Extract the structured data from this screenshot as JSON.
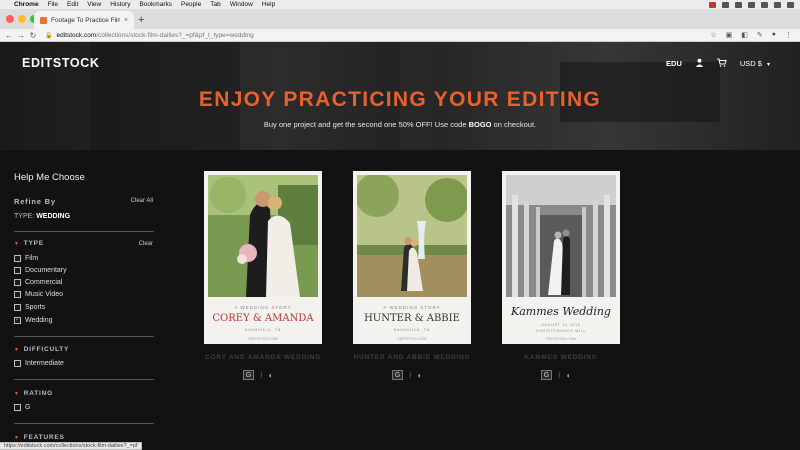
{
  "menubar": {
    "app": "Chrome",
    "items": [
      "File",
      "Edit",
      "View",
      "History",
      "Bookmarks",
      "People",
      "Tab",
      "Window",
      "Help"
    ]
  },
  "browser": {
    "tab_title": "Footage To Practice Film Editing",
    "url_host": "editstock.com",
    "url_path": "/collections/stock-film-dailies?_=pf&pf_t_type=wedding",
    "status_url": "https://editstock.com/collections/stock-film-dailies?_=pf"
  },
  "site": {
    "logo": "EDITSTOCK",
    "nav_edu": "EDU",
    "nav_currency": "USD $",
    "hero_title": "ENJOY PRACTICING YOUR EDITING",
    "hero_sub_pre": "Buy one project and get the second one 50% OFF! Use code ",
    "hero_code": "BOGO",
    "hero_sub_post": " on checkout."
  },
  "sidebar": {
    "title": "Help Me Choose",
    "refine_label": "Refine By",
    "clear_all": "Clear All",
    "active_filter_label": "TYPE:",
    "active_filter_value": "WEDDING",
    "sections": {
      "type": {
        "label": "TYPE",
        "clear": "Clear",
        "options": [
          {
            "label": "Film",
            "checked": false
          },
          {
            "label": "Documentary",
            "checked": false
          },
          {
            "label": "Commercial",
            "checked": false
          },
          {
            "label": "Music Video",
            "checked": false
          },
          {
            "label": "Sports",
            "checked": false
          },
          {
            "label": "Wedding",
            "checked": true
          }
        ]
      },
      "difficulty": {
        "label": "DIFFICULTY",
        "options": [
          {
            "label": "Intermediate",
            "checked": false
          }
        ]
      },
      "rating": {
        "label": "RATING",
        "options": [
          {
            "label": "G",
            "checked": false
          }
        ]
      },
      "next_section": {
        "label": "FEATURES"
      }
    }
  },
  "products": [
    {
      "title": "CORY AND AMANDA WEDDING",
      "card_story": "A WEDDING STORY",
      "card_names": "COREY & AMANDA",
      "card_place": "NASHVILLE, TN",
      "card_url": "EDITSTOCK.COM",
      "rating_badge": "G"
    },
    {
      "title": "HUNTER AND ABBIE WEDDING",
      "card_story": "A WEDDING STORY",
      "card_names": "HUNTER & ABBIE",
      "card_place": "NASHVILLE, TN",
      "card_url": "EDITSTOCK.COM",
      "rating_badge": "G"
    },
    {
      "title": "KAMMES WEDDING",
      "card_names": "Kammes Wedding",
      "card_date": "AUGUST 15 2015",
      "card_place": "CHRISTCHURCH MILL",
      "card_url": "EDITSTOCK.COM",
      "rating_badge": "G"
    }
  ],
  "colors": {
    "accent": "#e8612c",
    "page_bg": "#121212",
    "card_bg": "#f4f2ee"
  }
}
